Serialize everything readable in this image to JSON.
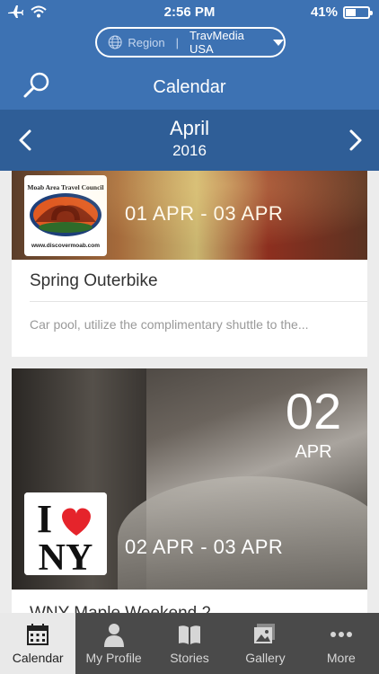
{
  "status": {
    "time": "2:56 PM",
    "battery": "41%",
    "battery_level": 0.41
  },
  "region": {
    "label": "Region",
    "value": "TravMedia USA"
  },
  "header": {
    "title": "Calendar"
  },
  "month_nav": {
    "month": "April",
    "year": "2016"
  },
  "events": [
    {
      "date_range": "01 APR - 03 APR",
      "title": "Spring Outerbike",
      "description": "Car pool, utilize the complimentary shuttle to the...",
      "logo_text": [
        "Moab Area Travel Council",
        "www.discovermoab.com"
      ]
    },
    {
      "day": "02",
      "month": "APR",
      "date_range": "02 APR - 03 APR",
      "title": "WNY Maple Weekend 2...",
      "logo_text": [
        "NY"
      ]
    }
  ],
  "tabs": [
    {
      "label": "Calendar",
      "icon": "calendar-icon",
      "active": true
    },
    {
      "label": "My Profile",
      "icon": "person-icon",
      "active": false
    },
    {
      "label": "Stories",
      "icon": "book-icon",
      "active": false
    },
    {
      "label": "Gallery",
      "icon": "gallery-icon",
      "active": false
    },
    {
      "label": "More",
      "icon": "more-icon",
      "active": false
    }
  ]
}
